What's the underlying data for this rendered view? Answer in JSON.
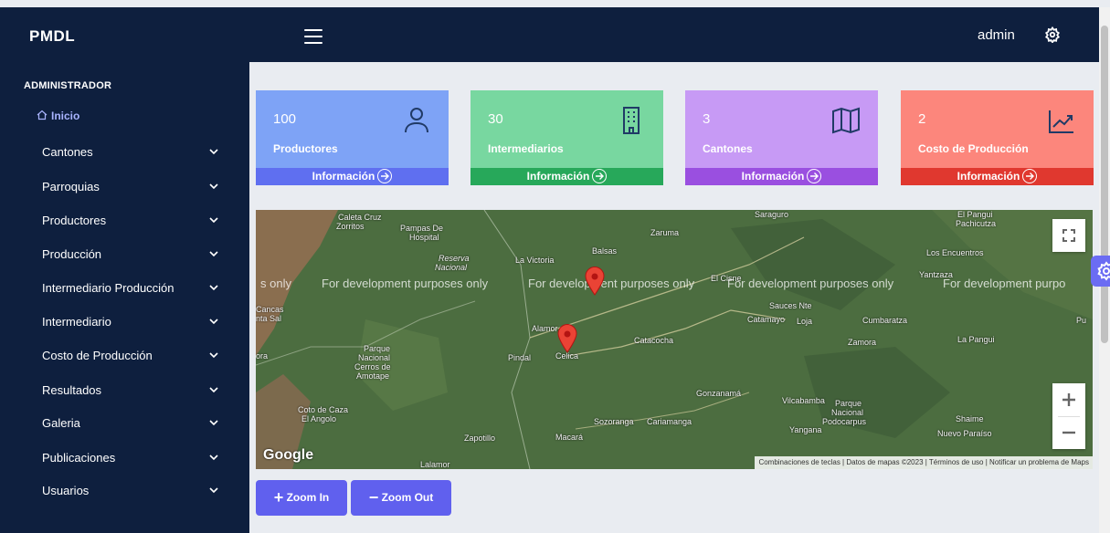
{
  "header": {
    "brand": "PMDL",
    "user": "admin"
  },
  "sidebar": {
    "section": "ADMINISTRADOR",
    "home": "Inicio",
    "items": [
      {
        "label": "Cantones"
      },
      {
        "label": "Parroquias"
      },
      {
        "label": "Productores"
      },
      {
        "label": "Producción"
      },
      {
        "label": "Intermediario Producción"
      },
      {
        "label": "Intermediario"
      },
      {
        "label": "Costo de Producción"
      },
      {
        "label": "Resultados"
      },
      {
        "label": "Galeria"
      },
      {
        "label": "Publicaciones"
      },
      {
        "label": "Usuarios"
      }
    ]
  },
  "cards": [
    {
      "value": "100",
      "label": "Productores",
      "footer": "Información",
      "icon": "user-icon",
      "color": "#7ea3f6",
      "footer_color": "#5f6ff0"
    },
    {
      "value": "30",
      "label": "Intermediarios",
      "footer": "Información",
      "icon": "building-icon",
      "color": "#78d7a0",
      "footer_color": "#27a85a"
    },
    {
      "value": "3",
      "label": "Cantones",
      "footer": "Información",
      "icon": "map-icon",
      "color": "#c79af5",
      "footer_color": "#9a4fe0"
    },
    {
      "value": "2",
      "label": "Costo de Producción",
      "footer": "Información",
      "icon": "chart-line-icon",
      "color": "#fc867c",
      "footer_color": "#e0382f"
    }
  ],
  "map": {
    "watermark": "For development purposes only",
    "watermark_partial_left": "s only",
    "watermark_partial_right": "For development purpo",
    "logo": "Google",
    "places": [
      "Caleta Cruz",
      "Zorritos",
      "Pampas De Hospital",
      "Zaruma",
      "La Victoria",
      "Balsas",
      "Saraguro",
      "El Pangui",
      "Pachicutza",
      "Los Encuentros",
      "Reserva Nacional",
      "El Cisne",
      "Yantzaza",
      "Sauces Nte",
      "Catamayo",
      "Loja",
      "Cumbaratza",
      "Cancas",
      "nta Sal",
      "Alamor",
      "Celica",
      "Pindal",
      "Catacocha",
      "Zamora",
      "La Pangui",
      "Parque Nacional Cerros de Amotape",
      "Gonzanamá",
      "Vilcabamba",
      "Parque Nacional Podocarpus",
      "Yangana",
      "Shaime",
      "Nuevo Paraíso",
      "Coto de Caza El Angolo",
      "Sozoranga",
      "Cariamanga",
      "Zapotillo",
      "Macará",
      "Lalamor",
      "ora",
      "Pu"
    ],
    "attribution": [
      "Combinaciones de teclas",
      "Datos de mapas ©2023",
      "Términos de uso",
      "Notificar un problema de Maps"
    ]
  },
  "buttons": {
    "zoom_in": "Zoom In",
    "zoom_out": "Zoom Out"
  }
}
